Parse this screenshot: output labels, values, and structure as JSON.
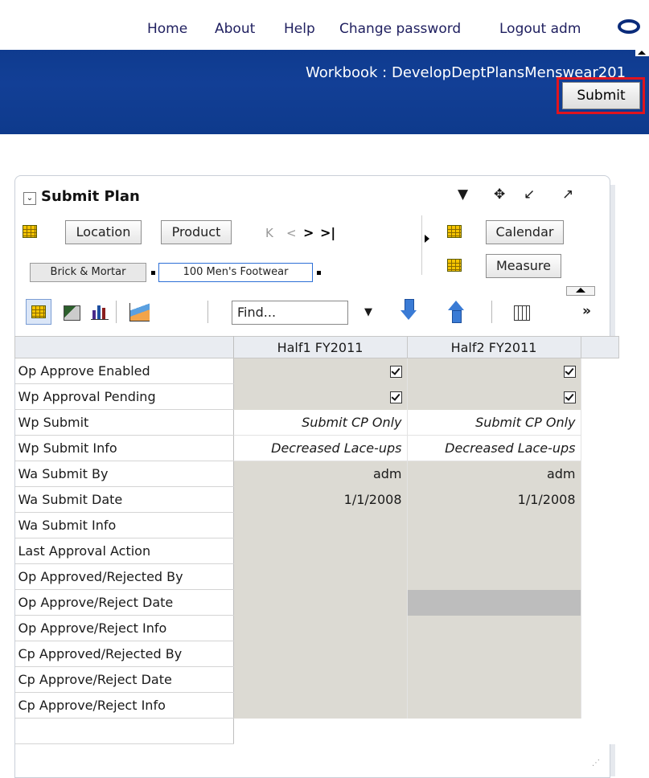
{
  "nav": {
    "home": "Home",
    "about": "About",
    "help": "Help",
    "change_password": "Change password",
    "logout": "Logout adm"
  },
  "workbook": {
    "title": "Workbook : DevelopDeptPlansMenswear201",
    "submit_label": "Submit"
  },
  "panel": {
    "title": "Submit Plan",
    "pivot": {
      "location": "Location",
      "product": "Product",
      "calendar": "Calendar",
      "measure": "Measure",
      "tile_location": "Brick & Mortar",
      "tile_product": "100 Men's Footwear"
    },
    "find_placeholder": "Find...",
    "columns": [
      "Half1 FY2011",
      "Half2 FY2011"
    ],
    "rows": [
      {
        "label": "Op Approve Enabled",
        "v1": "",
        "v2": "",
        "checkbox": true
      },
      {
        "label": "Wp Approval Pending",
        "v1": "",
        "v2": "",
        "checkbox": true
      },
      {
        "label": "Wp Submit",
        "v1": "Submit CP Only",
        "v2": "Submit CP Only"
      },
      {
        "label": "Wp Submit Info",
        "v1": "Decreased Lace-ups",
        "v2": "Decreased Lace-ups"
      },
      {
        "label": "Wa Submit By",
        "v1": "adm",
        "v2": "adm"
      },
      {
        "label": "Wa Submit Date",
        "v1": "1/1/2008",
        "v2": "1/1/2008"
      },
      {
        "label": "Wa Submit Info",
        "v1": "",
        "v2": ""
      },
      {
        "label": "Last Approval Action",
        "v1": "",
        "v2": ""
      },
      {
        "label": "Op Approved/Rejected By",
        "v1": "",
        "v2": ""
      },
      {
        "label": "Op Approve/Reject Date",
        "v1": "",
        "v2": ""
      },
      {
        "label": "Op Approve/Reject Info",
        "v1": "",
        "v2": ""
      },
      {
        "label": "Cp Approved/Rejected By",
        "v1": "",
        "v2": ""
      },
      {
        "label": "Cp Approve/Reject Date",
        "v1": "",
        "v2": ""
      },
      {
        "label": "Cp Approve/Reject Info",
        "v1": "",
        "v2": ""
      }
    ]
  },
  "colors": {
    "banner": "#123f96",
    "highlight": "#e0141e",
    "cell_gray": "#dcdad3"
  },
  "icons": {
    "expand": "collapse-toggle-icon",
    "menu": "dropdown-arrow-icon",
    "move": "move-icon",
    "restore": "restore-icon",
    "maximize": "maximize-icon",
    "first": "first-page-icon",
    "prev": "previous-icon",
    "next": "next-icon",
    "last": "last-page-icon",
    "pivot_grid": "grid-icon",
    "view_table": "table-view-icon",
    "view_chart": "chart-view-icon",
    "view_bar": "bar-chart-icon",
    "view_area": "area-chart-icon",
    "find_down": "find-next-icon",
    "find_up": "find-previous-icon",
    "columns": "column-settings-icon",
    "overflow": "overflow-icon"
  }
}
